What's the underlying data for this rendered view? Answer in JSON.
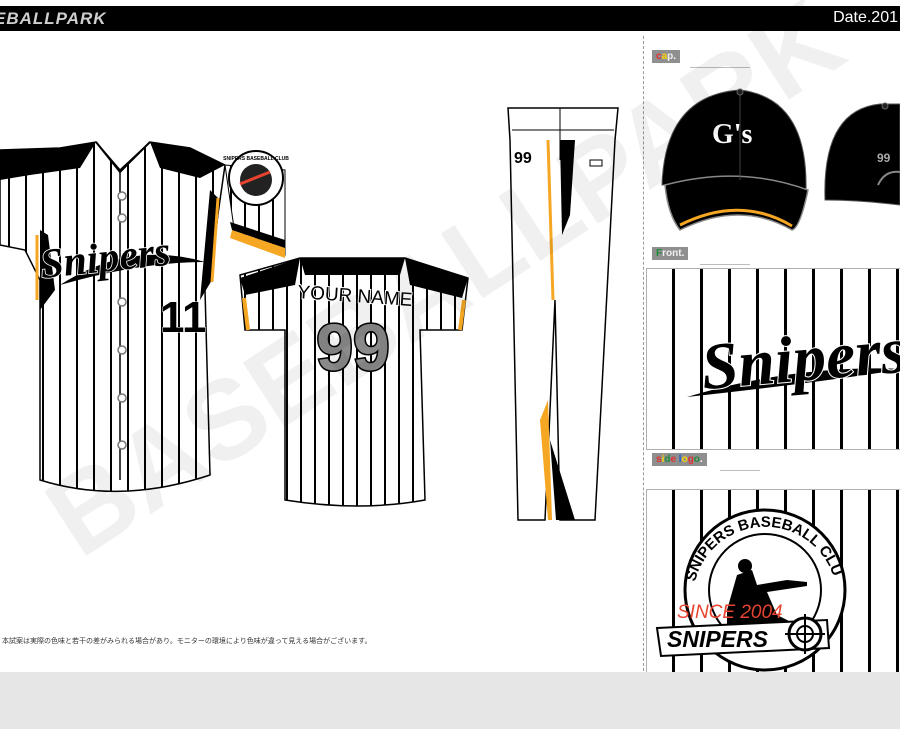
{
  "header": {
    "brand": "EBALLPARK",
    "date": "Date.201"
  },
  "watermark": "BASEBALLPARK",
  "jersey_front": {
    "logo": "Snipers",
    "number": "11"
  },
  "jersey_back": {
    "name": "YOUR NAME",
    "number": "99"
  },
  "pants": {
    "number": "99"
  },
  "sections": {
    "cap": {
      "label": "cap.",
      "letters": [
        "c",
        "a",
        "p",
        "."
      ],
      "colors": [
        "#e0302e",
        "#ffd500",
        "#f0f0f0",
        "#ffffff"
      ],
      "cap_logo": "G's",
      "cap_back_number": "99"
    },
    "front": {
      "label": "Front.",
      "letters": [
        "F",
        "r",
        "o",
        "n",
        "t",
        "."
      ],
      "colors": [
        "#1f8a3a",
        "#f0f0f0",
        "#f0f0f0",
        "#f0f0f0",
        "#f0f0f0",
        "#ffffff"
      ],
      "logo": "Snipers"
    },
    "side_logo": {
      "label": "side logo.",
      "letters": [
        "s",
        "i",
        "d",
        "e",
        " ",
        "l",
        "o",
        "g",
        "o",
        "."
      ],
      "colors": [
        "#e0302e",
        "#ffd500",
        "#1f8a3a",
        "#e0302e",
        "#ffffff",
        "#1f5fd0",
        "#ffd500",
        "#e0302e",
        "#1f8a3a",
        "#ffffff"
      ],
      "emblem_text": "SNIPERS BASEBALL CLUB",
      "since": "SINCE 2004",
      "team": "SNIPERS"
    }
  },
  "sleeve_patch": {
    "text": "SNIPERS BASEBALL CLUB"
  },
  "disclaimer": "本試案は実際の色味と若干の差がみられる場合があり。モニターの環境により色味が違って見える場合がございます。",
  "colors": {
    "accent": "#f5a623",
    "black": "#000000",
    "red": "#e8432f",
    "bar": "#000000",
    "background": "#e6e6e6"
  }
}
